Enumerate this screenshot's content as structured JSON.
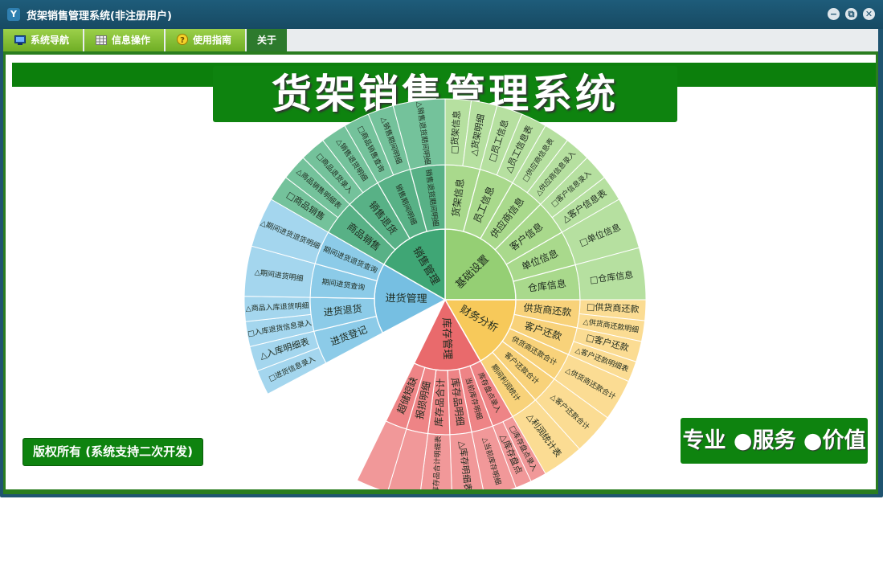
{
  "window": {
    "title": "货架销售管理系统(非注册用户)",
    "app_icon": "Y",
    "controls": {
      "minimize": "−",
      "restore": "⧉",
      "close": "✕"
    }
  },
  "menu": {
    "tabs": [
      {
        "label": "系统导航",
        "icon": "monitor-icon"
      },
      {
        "label": "信息操作",
        "icon": "grid-icon"
      },
      {
        "label": "使用指南",
        "icon": "help-icon"
      },
      {
        "label": "关于",
        "icon": ""
      }
    ]
  },
  "banner": {
    "title": "货架销售管理系统"
  },
  "copyright": "版权所有 (系统支持二次开发)",
  "slogan": "专业 ●服务 ●价值",
  "colors": {
    "base_settings": "#95cf74",
    "finance": "#f7c95a",
    "inventory": "#e96a6c",
    "purchase": "#76bfe2",
    "sales": "#3fa675",
    "banner_green": "#0e830f"
  },
  "sunburst": {
    "groups": [
      {
        "key": "base",
        "label": "基础设置",
        "children": [
          {
            "label": "货架信息",
            "items": [
              "□货架信息",
              "△货架明细"
            ]
          },
          {
            "label": "员工信息",
            "items": [
              "□员工信息",
              "△员工信息表"
            ]
          },
          {
            "label": "供应商信息",
            "items": [
              "□供应商信息表",
              "△供应商信息录入"
            ]
          },
          {
            "label": "客户信息",
            "items": [
              "□客户信息录入",
              "△客户信息表"
            ]
          },
          {
            "label": "单位信息",
            "items": [
              "□单位信息"
            ]
          },
          {
            "label": "仓库信息",
            "items": [
              "□仓库信息"
            ]
          }
        ]
      },
      {
        "key": "finance",
        "label": "财务分析",
        "children": [
          {
            "label": "供货商还款",
            "items": [
              "□供货商还款",
              "△供货商还款明细"
            ]
          },
          {
            "label": "客户还款",
            "items": [
              "□客户还款",
              "△客户还款明细表"
            ]
          },
          {
            "label": "供货商还款合计",
            "items": [
              "△供货商还款合计"
            ]
          },
          {
            "label": "客户还款合计",
            "items": [
              "△客户还款合计"
            ]
          },
          {
            "label": "期间利润统计",
            "items": [
              "△利润统计表"
            ]
          }
        ]
      },
      {
        "key": "inventory",
        "label": "库存管理",
        "children": [
          {
            "label": "库存盘点录入",
            "items": [
              "□库存盘点录入",
              "△库存盘点"
            ]
          },
          {
            "label": "当前库存明细",
            "items": [
              "△当前库存明细"
            ]
          },
          {
            "label": "库存品明细",
            "items": [
              "△库存明细表"
            ]
          },
          {
            "label": "库存品合计",
            "items": [
              "△库存品合计明细表"
            ]
          },
          {
            "label": "报损明细",
            "items": []
          },
          {
            "label": "超储短缺",
            "items": []
          }
        ]
      },
      {
        "key": "purchase",
        "label": "进货管理",
        "children": [
          {
            "label": "进货登记",
            "items": [
              "□进货信息录入",
              "△入库明细表"
            ]
          },
          {
            "label": "进货退货",
            "items": [
              "□入库退货信息录入",
              "△商品入库退货明细"
            ]
          },
          {
            "label": "期间进货查询",
            "items": [
              "△期间进货明细"
            ]
          },
          {
            "label": "期间进货退货查询",
            "items": [
              "△期间进货退货明细"
            ]
          }
        ]
      },
      {
        "key": "sales",
        "label": "销售管理",
        "children": [
          {
            "label": "商品销售",
            "items": [
              "□商品销售",
              "△商品销售明细表"
            ]
          },
          {
            "label": "销售退货",
            "items": [
              "□商品退货录入",
              "△销售退货明细"
            ]
          },
          {
            "label": "销售期间明细",
            "items": [
              "□商品销售查询",
              "△销售期间明细"
            ]
          },
          {
            "label": "销售退货期间明细",
            "items": [
              "△销售退货期间明细"
            ]
          }
        ]
      }
    ]
  }
}
